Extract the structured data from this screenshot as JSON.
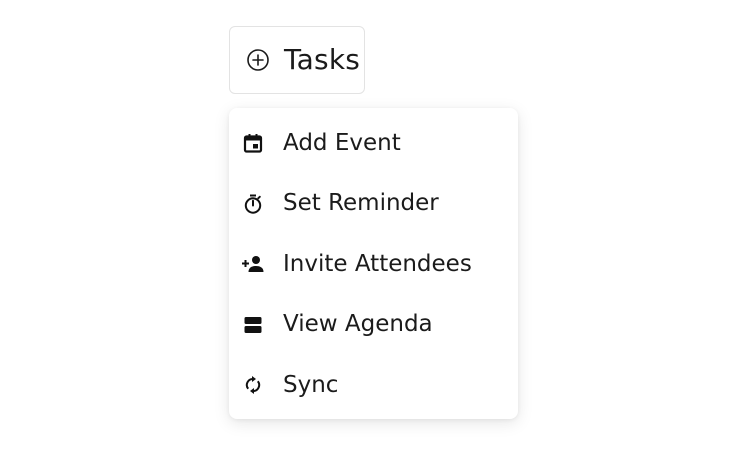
{
  "trigger": {
    "label": "Tasks",
    "icon": "add-circle-icon"
  },
  "menu": {
    "items": [
      {
        "label": "Add Event",
        "icon": "calendar-event-icon"
      },
      {
        "label": "Set Reminder",
        "icon": "timer-icon"
      },
      {
        "label": "Invite Attendees",
        "icon": "person-add-icon"
      },
      {
        "label": "View Agenda",
        "icon": "view-agenda-icon"
      },
      {
        "label": "Sync",
        "icon": "sync-icon"
      }
    ]
  },
  "colors": {
    "text": "#1b1b1b",
    "border": "#e3e3e3",
    "background": "#ffffff"
  }
}
